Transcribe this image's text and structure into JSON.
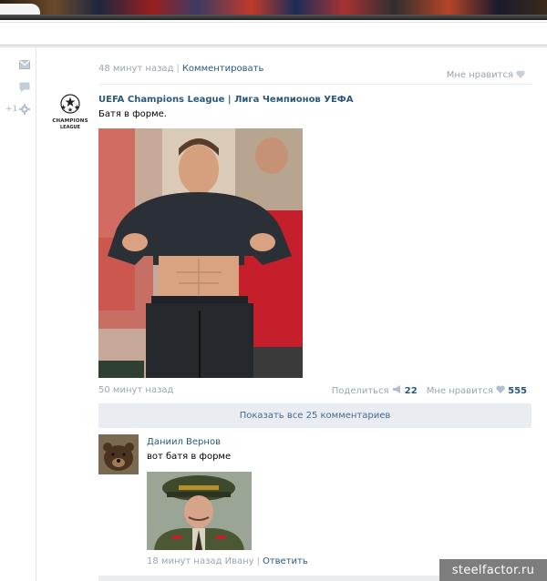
{
  "feed": {
    "prev_post": {
      "time": "48 минут назад",
      "comment_link": "Комментировать",
      "like_label": "Мне нравится"
    },
    "post": {
      "author": "UEFA Champions League | Лига Чемпионов УЕФА",
      "text": "Батя в форме.",
      "time": "50 минут назад",
      "share_label": "Поделиться",
      "share_count": "22",
      "like_label": "Мне нравится",
      "like_count": "555",
      "show_all_comments": "Показать все 25 комментариев"
    },
    "comment": {
      "author": "Даниил Вернов",
      "text": "вот батя в форме",
      "meta": "18 минут назад Ивану",
      "reply_link": "Ответить"
    }
  },
  "logo": {
    "line1": "CHAMPIONS",
    "line2": "LEAGUE"
  },
  "sidebar": {
    "plus_label": "+1"
  },
  "watermark": "steelfactor.ru",
  "icons": [
    "mail-icon",
    "comment-icon",
    "gear-icon",
    "heart-icon",
    "megaphone-icon",
    "starball-icon"
  ],
  "colors": {
    "link": "#2b587a",
    "meta": "#9aa4b0",
    "button_bg": "#e9edf1",
    "heart": "#c5d0dc"
  }
}
